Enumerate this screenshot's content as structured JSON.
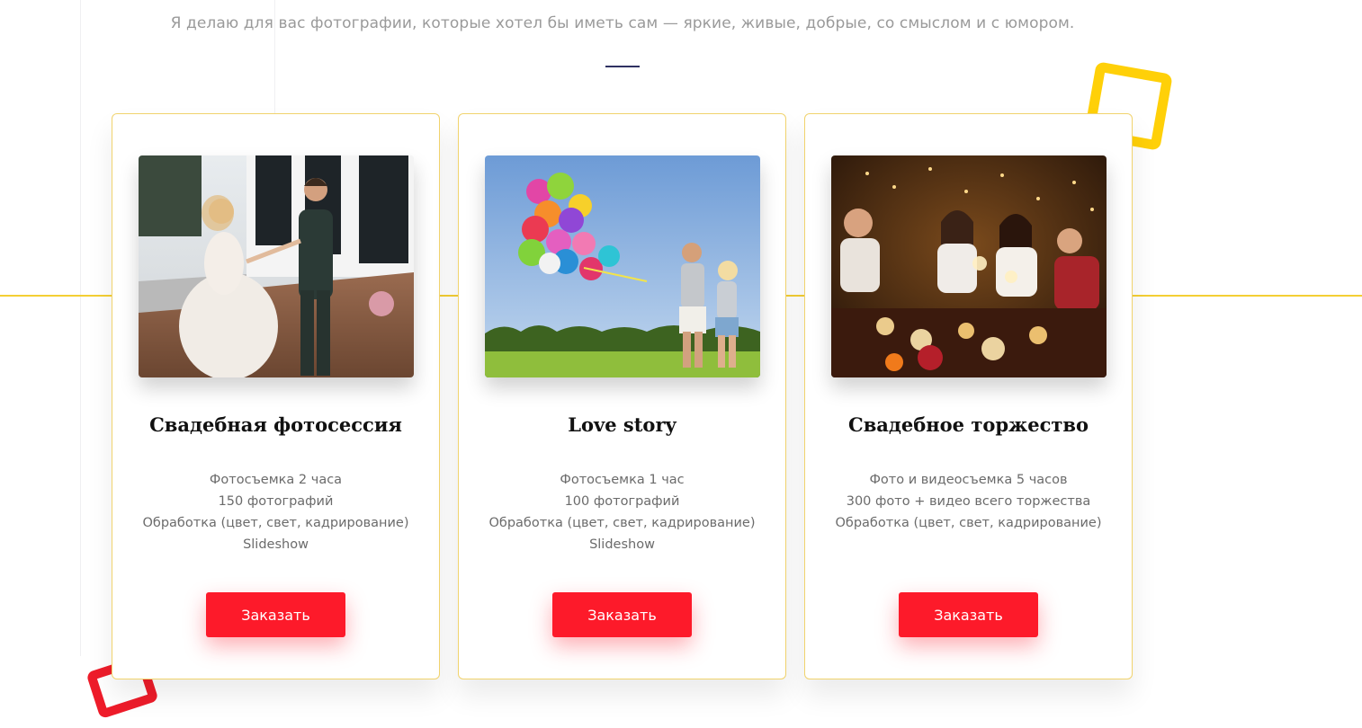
{
  "intro": {
    "text": "Я делаю для вас фотографии, которые хотел бы иметь сам — яркие, живые, добрые, со смыслом и с юмором."
  },
  "colors": {
    "accent_yellow": "#ffd008",
    "accent_red": "#fd1a2a",
    "underline_navy": "#2f3162"
  },
  "services": [
    {
      "title": "Свадебная фотосессия",
      "features": [
        "Фотосъемка 2 часа",
        "150 фотографий",
        "Обработка (цвет, свет, кадрирование)",
        "Slideshow"
      ],
      "button_label": "Заказать"
    },
    {
      "title": "Love story",
      "features": [
        "Фотосъемка 1 час",
        "100 фотографий",
        "Обработка (цвет, свет, кадрирование)",
        "Slideshow"
      ],
      "button_label": "Заказать"
    },
    {
      "title": "Свадебное торжество",
      "features": [
        "Фото и видеосъемка 5 часов",
        "300 фото + видео всего торжества",
        "Обработка (цвет, свет, кадрирование)"
      ],
      "button_label": "Заказать"
    }
  ]
}
